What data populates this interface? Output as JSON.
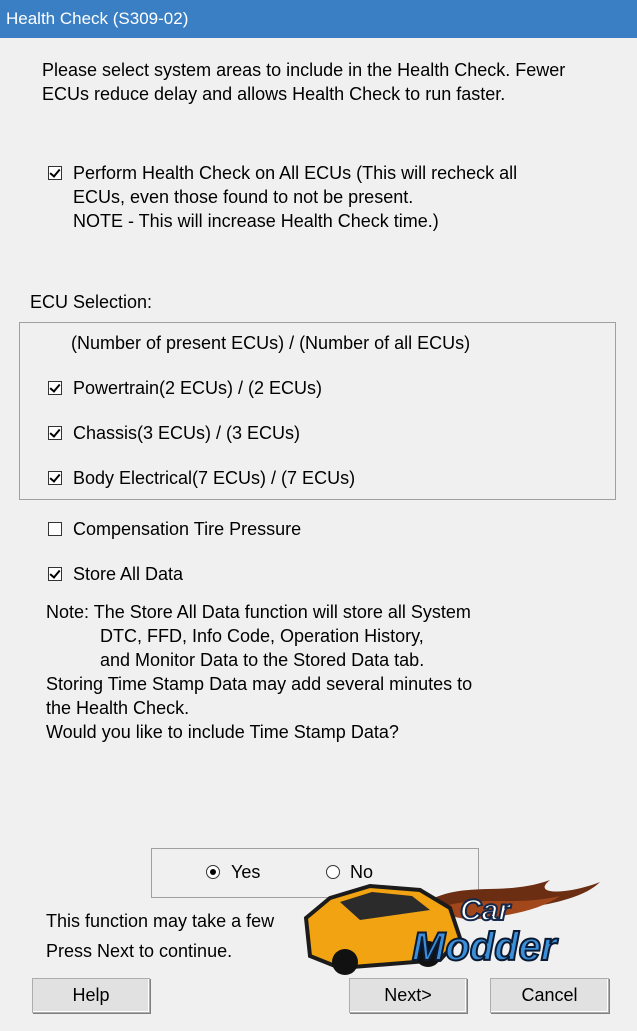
{
  "window": {
    "title": "Health Check (S309-02)"
  },
  "intro": {
    "line1": "Please select system areas to include in the Health Check. Fewer",
    "line2": "ECUs reduce delay and allows Health Check to run faster."
  },
  "all_ecus": {
    "checked": true,
    "line1": "Perform Health Check on All ECUs (This will recheck all",
    "line2": "ECUs, even those found to not be present.",
    "line3": "NOTE - This will increase Health Check time.)"
  },
  "ecu_selection": {
    "heading": "ECU Selection:",
    "column_note": "(Number of present ECUs) / (Number of all ECUs)",
    "items": [
      {
        "label": "Powertrain(2 ECUs) / (2 ECUs)",
        "checked": true
      },
      {
        "label": "Chassis(3 ECUs) / (3 ECUs)",
        "checked": true
      },
      {
        "label": "Body Electrical(7 ECUs) / (7 ECUs)",
        "checked": true
      }
    ]
  },
  "compensation": {
    "label": "Compensation Tire Pressure",
    "checked": false
  },
  "store_all": {
    "label": "Store All Data",
    "checked": true
  },
  "note": {
    "line1": "Note: The Store All Data function will store all System",
    "line2": "DTC, FFD, Info Code, Operation History,",
    "line3": "and Monitor Data to the Stored Data tab.",
    "line4": "Storing Time Stamp Data may add several minutes to",
    "line5": "the Health Check.",
    "line6": "Would you like to include Time Stamp Data?"
  },
  "time_stamp": {
    "yes_label": "Yes",
    "no_label": "No",
    "selected": "Yes"
  },
  "footer": {
    "line1": "This function may take a few",
    "line2": "Press Next to continue."
  },
  "buttons": {
    "help": "Help",
    "next": "Next>",
    "cancel": "Cancel"
  },
  "watermark": {
    "line1": "Car",
    "line2": "Modder"
  },
  "colors": {
    "titlebar": "#3a7fc4",
    "background": "#f0f0f0"
  }
}
